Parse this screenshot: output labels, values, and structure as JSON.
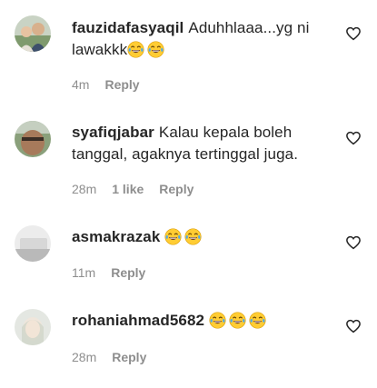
{
  "comments": [
    {
      "username": "fauzidafasyaqil",
      "text": "Aduhhlaaa...yg ni lawakkk",
      "emoji_count": 2,
      "time": "4m",
      "likes": "",
      "reply_label": "Reply"
    },
    {
      "username": "syafiqjabar",
      "text": "Kalau kepala boleh tanggal, agaknya tertinggal juga.",
      "emoji_count": 0,
      "time": "28m",
      "likes": "1 like",
      "reply_label": "Reply"
    },
    {
      "username": "asmakrazak",
      "text": "",
      "emoji_count": 2,
      "time": "11m",
      "likes": "",
      "reply_label": "Reply"
    },
    {
      "username": "rohaniahmad5682",
      "text": "",
      "emoji_count": 3,
      "time": "28m",
      "likes": "",
      "reply_label": "Reply"
    }
  ],
  "icons": {
    "emoji": "face-with-tears-of-joy-icon",
    "like": "heart-icon"
  },
  "colors": {
    "text": "#262626",
    "meta": "#8e8e8e",
    "emoji_face": "#FFCC33",
    "emoji_tears": "#4FA8E8"
  }
}
